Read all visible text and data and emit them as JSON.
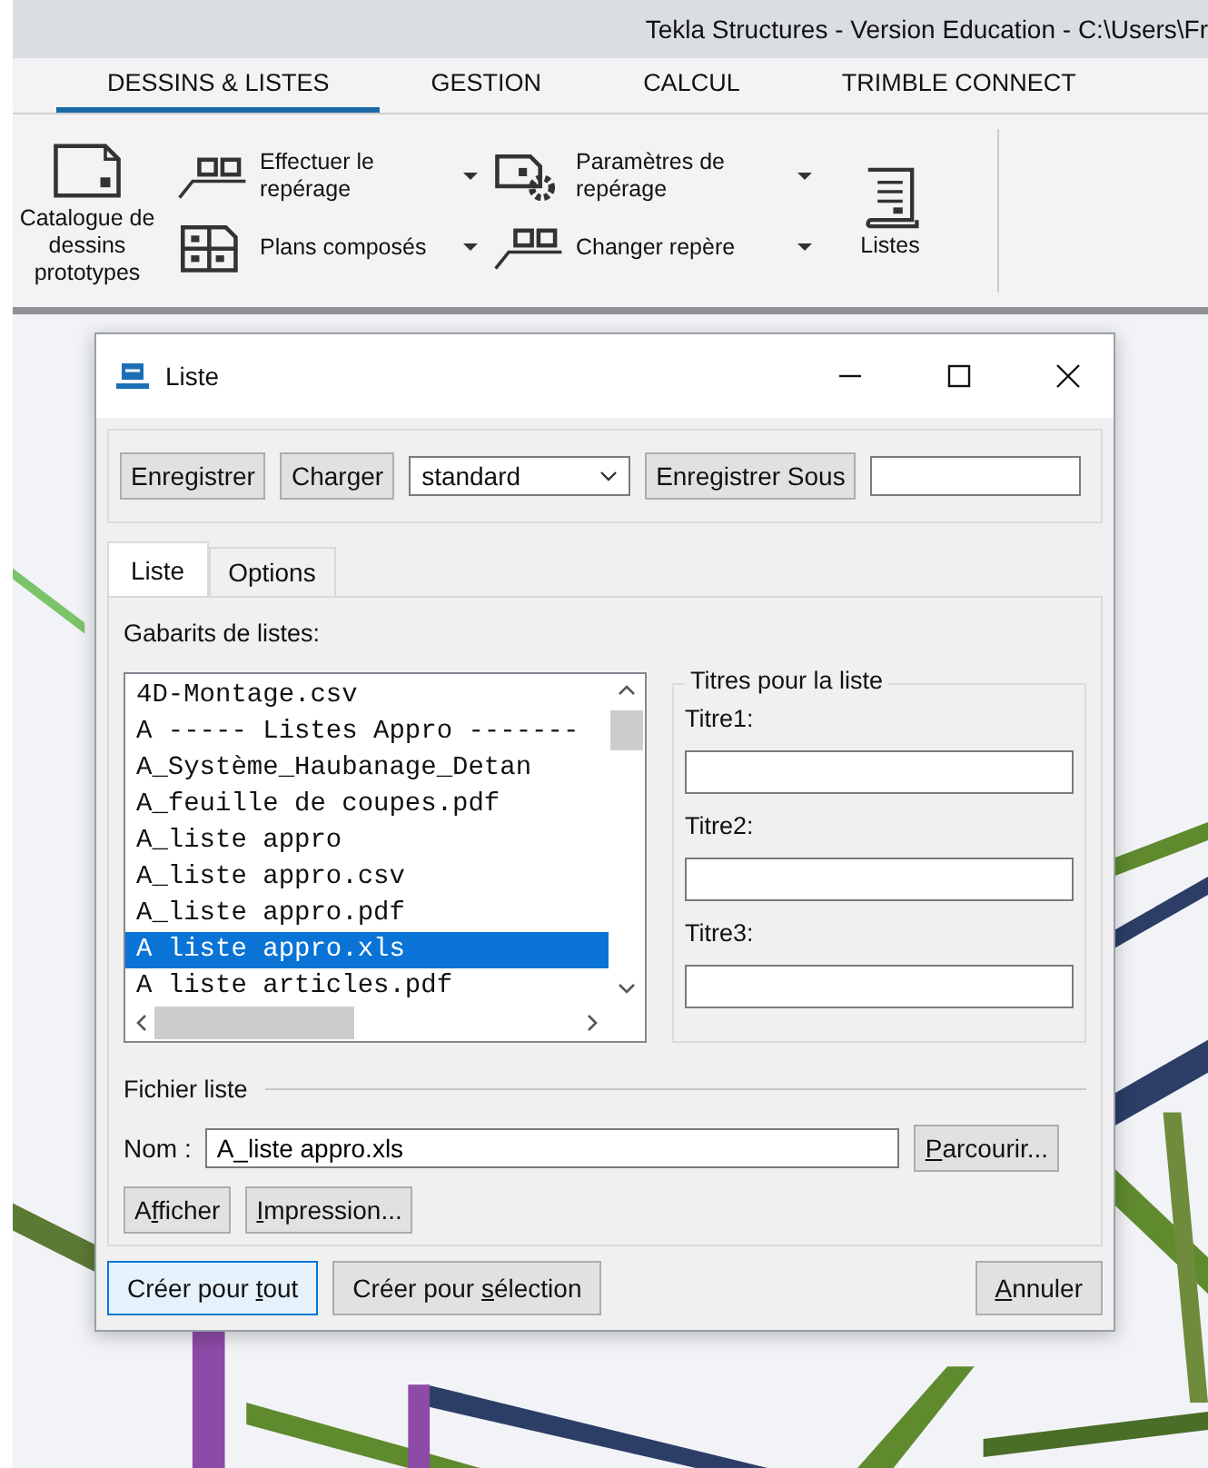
{
  "app_title": "Tekla Structures - Version Education - C:\\Users\\Fr",
  "ribbon": {
    "tabs": [
      {
        "label": "DESSINS & LISTES",
        "selected": true
      },
      {
        "label": "GESTION",
        "selected": false
      },
      {
        "label": "CALCUL",
        "selected": false
      },
      {
        "label": "TRIMBLE CONNECT",
        "selected": false
      }
    ],
    "columns": [
      {
        "items": [
          {
            "label": "Catalogue de dessins prototypes",
            "kind": "large",
            "dropdown": false
          }
        ]
      },
      {
        "items": [
          {
            "label": "Effectuer le repérage",
            "kind": "small",
            "dropdown": true
          },
          {
            "label": "Plans composés",
            "kind": "small",
            "dropdown": true
          }
        ]
      },
      {
        "items": [
          {
            "label": "Paramètres de repérage",
            "kind": "small",
            "dropdown": true
          },
          {
            "label": "Changer repère",
            "kind": "small",
            "dropdown": true
          }
        ]
      },
      {
        "items": [
          {
            "label": "Listes",
            "kind": "large",
            "dropdown": false
          }
        ]
      }
    ]
  },
  "dialog": {
    "title": "Liste",
    "toolbar": {
      "save": "Enregistrer",
      "load": "Charger",
      "preset": "standard",
      "save_as": "Enregistrer Sous"
    },
    "tabs": [
      {
        "label": "Liste",
        "selected": true
      },
      {
        "label": "Options",
        "selected": false
      }
    ],
    "templates_label": "Gabarits de listes:",
    "templates": [
      {
        "label": "4D-Montage.csv",
        "selected": false
      },
      {
        "label": "A ----- Listes Appro -------",
        "selected": false
      },
      {
        "label": "A_Système_Haubanage_Detan",
        "selected": false
      },
      {
        "label": "A_feuille de coupes.pdf",
        "selected": false
      },
      {
        "label": "A_liste appro",
        "selected": false
      },
      {
        "label": "A_liste appro.csv",
        "selected": false
      },
      {
        "label": "A_liste appro.pdf",
        "selected": false
      },
      {
        "label": "A liste appro.xls",
        "selected": true
      },
      {
        "label": "A liste articles.pdf",
        "selected": false
      }
    ],
    "titles_group": "Titres pour la liste",
    "titles": [
      {
        "label": "Titre1:"
      },
      {
        "label": "Titre2:"
      },
      {
        "label": "Titre3:"
      }
    ],
    "file_group": "Fichier liste",
    "name_label": "Nom :",
    "name_value": "A_liste appro.xls",
    "browse": {
      "key": "P",
      "after": "arcourir..."
    },
    "show": {
      "before": "A",
      "key": "f",
      "after": "ficher"
    },
    "print": {
      "key": "I",
      "after": "mpression..."
    },
    "footer": [
      {
        "before": "Créer pour ",
        "key": "t",
        "after": "out",
        "focused": true
      },
      {
        "before": "Créer pour ",
        "key": "s",
        "after": "élection",
        "focused": false
      }
    ],
    "cancel": {
      "key": "A",
      "after": "nnuler"
    }
  }
}
